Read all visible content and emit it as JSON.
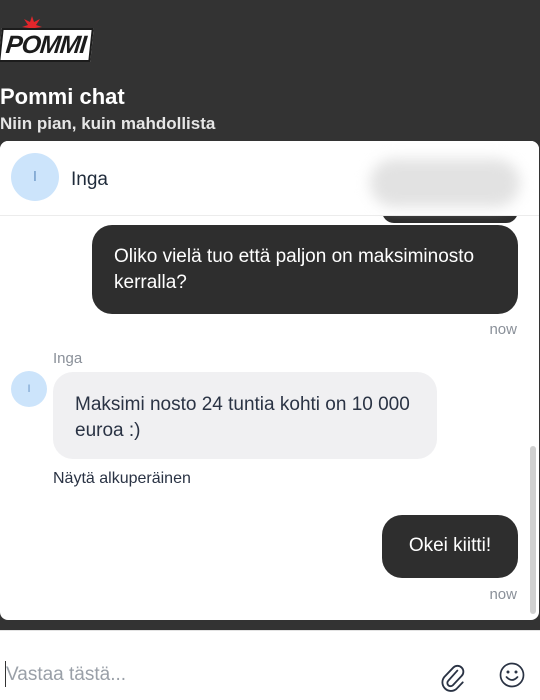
{
  "brand": {
    "logo_text": "POMMI"
  },
  "header": {
    "title": "Pommi chat",
    "subtitle": "Niin pian, kuin mahdollista"
  },
  "agent": {
    "initial": "I",
    "name": "Inga"
  },
  "messages": [
    {
      "from": "user",
      "text": "Oliko vielä tuo että paljon on maksiminosto kerralla?",
      "time": "now"
    },
    {
      "from": "agent",
      "sender": "Inga",
      "text": "Maksimi nosto 24 tuntia kohti on 10 000 euroa :)",
      "action": "Näytä alkuperäinen"
    },
    {
      "from": "user",
      "text": "Okei kiitti!",
      "time": "now"
    }
  ],
  "composer": {
    "placeholder": "Vastaa tästä...",
    "attach_icon": "paperclip-icon",
    "emoji_icon": "smiley-icon"
  },
  "colors": {
    "header_bg": "#333333",
    "user_bubble": "#2e2e2e",
    "agent_bubble": "#f0f0f2",
    "avatar_bg": "#cce4fb"
  }
}
